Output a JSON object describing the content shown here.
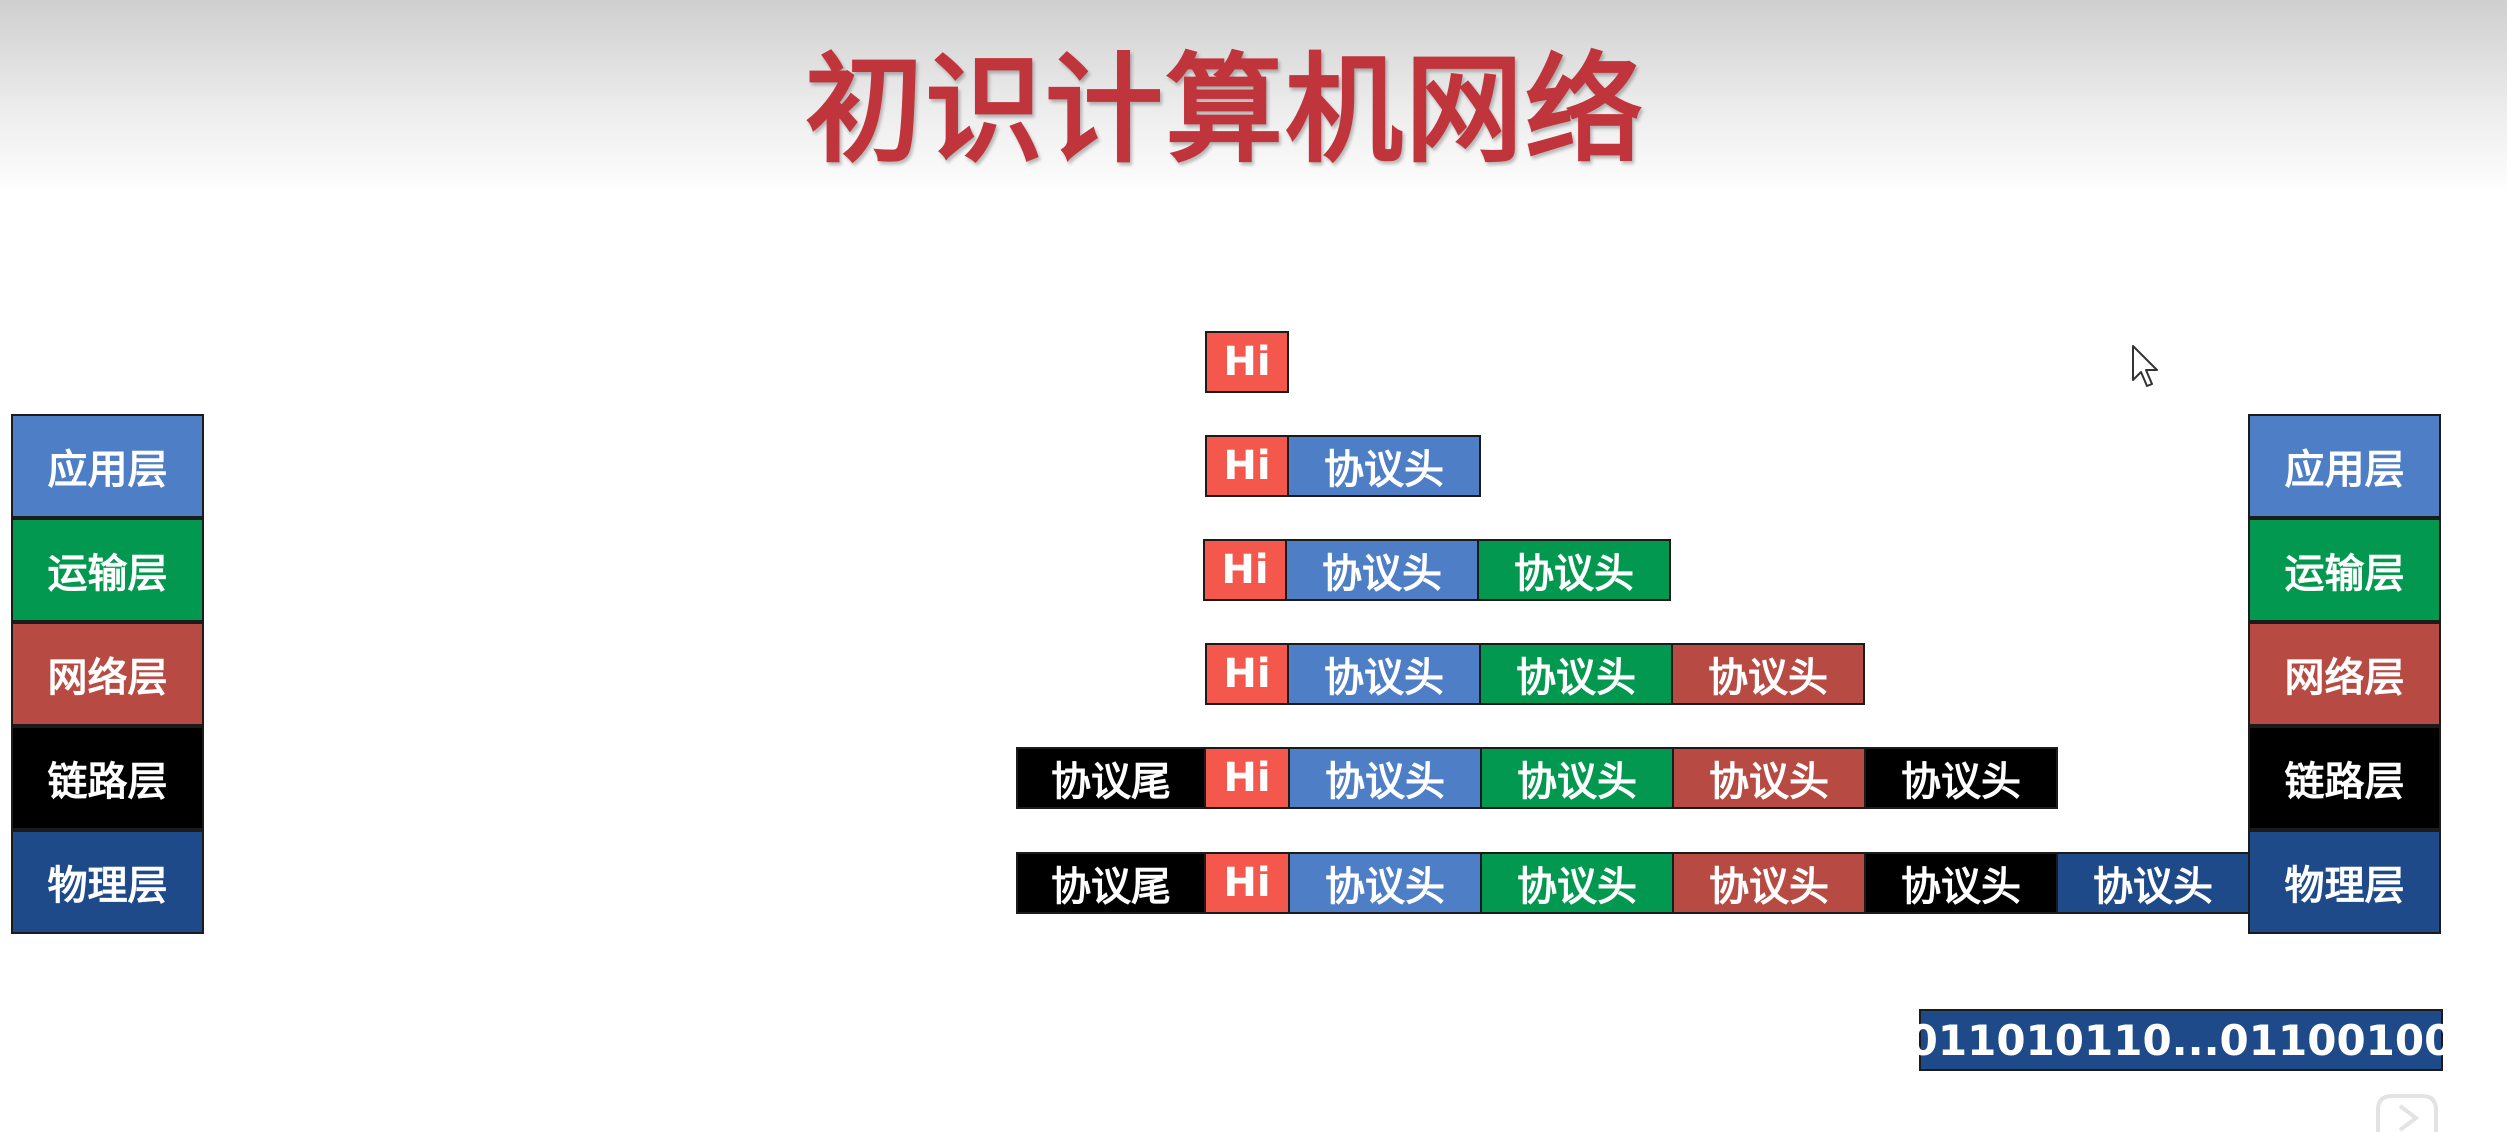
{
  "title": "初识计算机网络",
  "colors": {
    "title": "#c0343b",
    "data_hi": "#f4574b",
    "application": "#4d7ec6",
    "transport": "#03984f",
    "network": "#b74b43",
    "link": "#000000",
    "physical": "#1f4a8a"
  },
  "left_stack": [
    {
      "label": "应用层"
    },
    {
      "label": "运输层"
    },
    {
      "label": "网络层"
    },
    {
      "label": "链路层"
    },
    {
      "label": "物理层"
    }
  ],
  "right_stack": [
    {
      "label": "应用层"
    },
    {
      "label": "运输层"
    },
    {
      "label": "网络层"
    },
    {
      "label": "链路层"
    },
    {
      "label": "物理层"
    }
  ],
  "rows": [
    {
      "segments": [
        {
          "text": "Hi",
          "color": "#f4574b"
        }
      ]
    },
    {
      "segments": [
        {
          "text": "Hi",
          "color": "#f4574b"
        },
        {
          "text": "协议头",
          "color": "#4d7ec6"
        }
      ]
    },
    {
      "segments": [
        {
          "text": "Hi",
          "color": "#f4574b"
        },
        {
          "text": "协议头",
          "color": "#4d7ec6"
        },
        {
          "text": "协议头",
          "color": "#03984f"
        }
      ]
    },
    {
      "segments": [
        {
          "text": "Hi",
          "color": "#f4574b"
        },
        {
          "text": "协议头",
          "color": "#4d7ec6"
        },
        {
          "text": "协议头",
          "color": "#03984f"
        },
        {
          "text": "协议头",
          "color": "#b74b43"
        }
      ]
    },
    {
      "segments": [
        {
          "text": "协议尾",
          "color": "#000000"
        },
        {
          "text": "Hi",
          "color": "#f4574b"
        },
        {
          "text": "协议头",
          "color": "#4d7ec6"
        },
        {
          "text": "协议头",
          "color": "#03984f"
        },
        {
          "text": "协议头",
          "color": "#b74b43"
        },
        {
          "text": "协议头",
          "color": "#000000"
        }
      ]
    },
    {
      "segments": [
        {
          "text": "协议尾",
          "color": "#000000"
        },
        {
          "text": "Hi",
          "color": "#f4574b"
        },
        {
          "text": "协议头",
          "color": "#4d7ec6"
        },
        {
          "text": "协议头",
          "color": "#03984f"
        },
        {
          "text": "协议头",
          "color": "#b74b43"
        },
        {
          "text": "协议头",
          "color": "#000000"
        },
        {
          "text": "协议头",
          "color": "#1f4a8a"
        }
      ]
    }
  ],
  "bitstream": "011010110...01100100",
  "icons": {
    "cursor": "mouse-pointer-icon",
    "corner": "play-control-icon"
  }
}
